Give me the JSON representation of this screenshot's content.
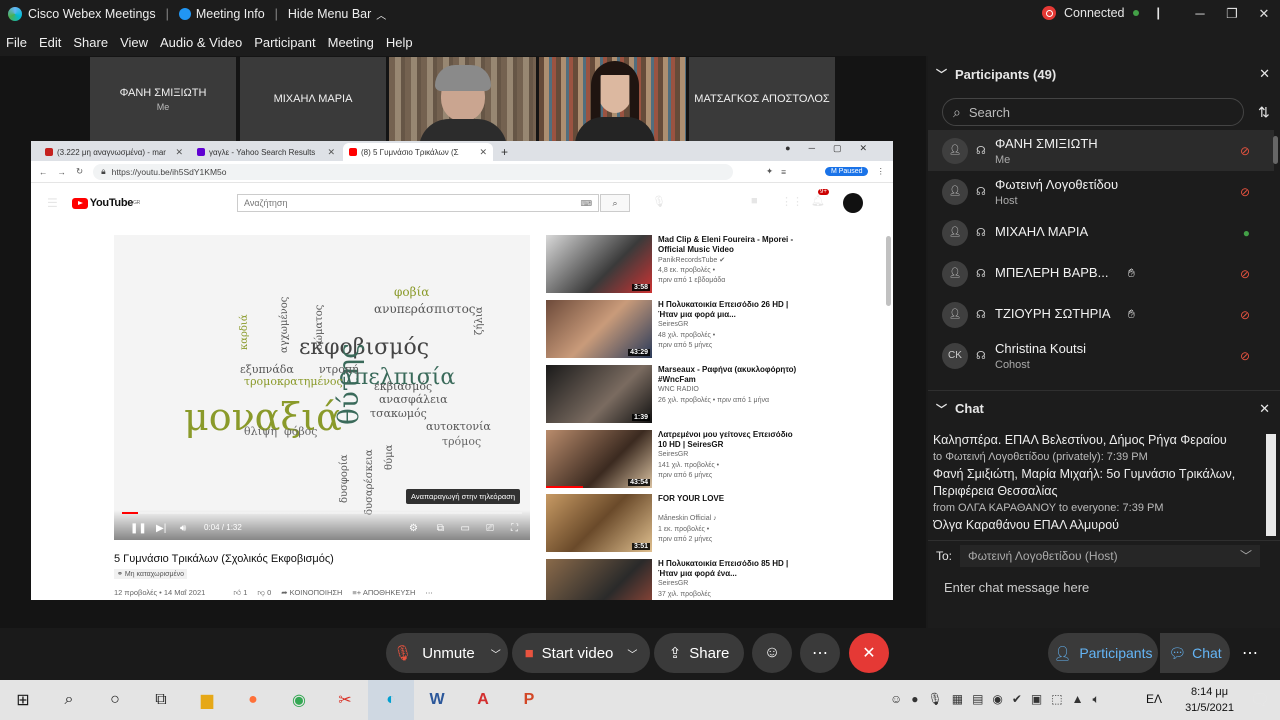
{
  "titlebar": {
    "app": "Cisco Webex Meetings",
    "meeting_info": "Meeting Info",
    "hide_menu": "Hide Menu Bar",
    "status": "Connected"
  },
  "menu": [
    "File",
    "Edit",
    "Share",
    "View",
    "Audio & Video",
    "Participant",
    "Meeting",
    "Help"
  ],
  "thumbnails": [
    {
      "name": "ΦΑΝΗ ΣΜΙΞΙΩΤΗ",
      "sub": "Me"
    },
    {
      "name": "ΜΙΧΑΗΛ ΜΑΡΙΑ",
      "sub": ""
    },
    {
      "name": "ΜΑΤΣΑΓΚΟΣ ΑΠΟΣΤΟΛΟΣ",
      "sub": ""
    }
  ],
  "browser": {
    "tabs": [
      {
        "label": "(3.222 μη αναγνωσμένα) - mar",
        "color": "#c5221f"
      },
      {
        "label": "γαγλε - Yahoo Search Results",
        "color": "#6001d2"
      },
      {
        "label": "(8) 5 Γυμνάσιο Τρικάλων (Σ",
        "color": "#ff0000"
      }
    ],
    "url": "https://youtu.be/ih5SdY1KM5o",
    "profile_status": "Paused",
    "profile_initial": "M",
    "search_placeholder": "Αναζήτηση",
    "logo": "YouTube",
    "logo_region": "GR",
    "notifications": "9+"
  },
  "video": {
    "tooltip": "Αναπαραγωγή στην τηλεόραση",
    "time": "0:04 / 1:32",
    "progress": 0.04,
    "title": "5 Γυμνάσιο Τρικάλων (Σχολικός Εκφοβισμός)",
    "badge": "Μη καταχωρισμένο",
    "views_date": "12 προβολές • 14 Μαΐ 2021",
    "likes": "1",
    "dislikes": "0",
    "share": "ΚΟΙΝΟΠΟΙΗΣΗ",
    "save": "ΑΠΟΘΗΚΕΥΣΗ",
    "words": [
      "μοναξιά",
      "εκφοβισμός",
      "απελπισία",
      "θύτης",
      "φοβία",
      "ανυπεράσπιστος",
      "φόβος",
      "θλίψη",
      "τρόμος",
      "αυτοκτονία",
      "τσακωμός",
      "ανασφάλεια",
      "εκβιασμός",
      "τρομοκρατημένος",
      "εξυπνάδα",
      "ντροπή",
      "δυσφορία",
      "καρδιά",
      "αγχωμένος",
      "θύμα",
      "σώματος",
      "δυσαρέσκεια",
      "ζήλια"
    ]
  },
  "recommended": [
    {
      "title": "Mad Clip & Eleni Foureira - Mporei - Official Music Video",
      "channel": "PanikRecordsTube ✔",
      "views": "4,8 εκ. προβολές •",
      "age": "πριν από 1 εβδομάδα",
      "dur": "3:58",
      "progress": 0.0
    },
    {
      "title": "Η Πολυκατοικία Επεισόδιο 26 HD | Ήταν μια φορά μια...",
      "channel": "SeiresGR",
      "views": "48 χιλ. προβολές •",
      "age": "πριν από 5 μήνες",
      "dur": "43:29",
      "progress": 0.0
    },
    {
      "title": "Marseaux - Ραφήνα (ακυκλοφόρητο) #WncFam",
      "channel": "WNC RADIO",
      "views": "26 χιλ. προβολές • πριν από 1 μήνα",
      "age": "",
      "dur": "1:39",
      "progress": 0.0
    },
    {
      "title": "Λατρεμένοι μου γείτονες Επεισόδιο 10 HD | SeiresGR",
      "channel": "SeiresGR",
      "views": "141 χιλ. προβολές •",
      "age": "πριν από 6 μήνες",
      "dur": "43:54",
      "progress": 0.35
    },
    {
      "title": "FOR YOUR LOVE",
      "channel": "Måneskin Official ♪",
      "views": "1 εκ. προβολές •",
      "age": "πριν από 2 μήνες",
      "dur": "3:51",
      "progress": 0.0
    },
    {
      "title": "Η Πολυκατοικία Επεισόδιο 85 HD | Ήταν μια φορά ένα...",
      "channel": "SeiresGR",
      "views": "37 χιλ. προβολές",
      "age": "",
      "dur": "",
      "progress": 0.0
    }
  ],
  "participants": {
    "header": "Participants (49)",
    "search": "Search",
    "list": [
      {
        "name": "ΦΑΝΗ ΣΜΙΞΙΩΤΗ",
        "role": "Me",
        "muted": true,
        "hand": false,
        "initials": ""
      },
      {
        "name": "Φωτεινή Λογοθετίδου",
        "role": "Host",
        "muted": true,
        "hand": false,
        "initials": ""
      },
      {
        "name": "ΜΙΧΑΗΛ ΜΑΡΙΑ",
        "role": "",
        "muted": false,
        "hand": false,
        "initials": ""
      },
      {
        "name": "ΜΠΕΛΕΡΗ ΒΑΡΒ...",
        "role": "",
        "muted": true,
        "hand": true,
        "initials": ""
      },
      {
        "name": "ΤΖΙΟΥΡΗ ΣΩΤΗΡΙΑ",
        "role": "",
        "muted": true,
        "hand": true,
        "initials": ""
      },
      {
        "name": "Christina Koutsi",
        "role": "Cohost",
        "muted": true,
        "hand": false,
        "initials": "CK"
      }
    ]
  },
  "chat": {
    "header": "Chat",
    "messages": [
      {
        "type": "text",
        "text": "Καλησπέρα. ΕΠΑΛ Βελεστίνου, Δήμος Ρήγα Φεραίου"
      },
      {
        "type": "meta",
        "text": "to Φωτεινή Λογοθετίδου (privately):    7:39 PM"
      },
      {
        "type": "text",
        "text": "Φανή Σμιξιώτη, Μαρία Μιχαήλ: 5ο Γυμνάσιο Τρικάλων, Περιφέρεια Θεσσαλίας"
      },
      {
        "type": "meta",
        "text": "from ΟΛΓΑ ΚΑΡΑΘΑΝΟΥ to everyone:    7:39 PM"
      },
      {
        "type": "text",
        "text": "Όλγα Καραθάνου ΕΠΑΛ Αλμυρού"
      }
    ],
    "to_label": "To:",
    "to_value": "Φωτεινή Λογοθετίδου (Host)",
    "input_placeholder": "Enter chat message here"
  },
  "controls": {
    "unmute": "Unmute",
    "start_video": "Start video",
    "share": "Share",
    "participants": "Participants",
    "chat": "Chat"
  },
  "taskbar": {
    "lang": "ΕΛ",
    "time": "8:14 μμ",
    "date": "31/5/2021"
  },
  "colors": {
    "end_call": "#e53935",
    "accent": "#64b5f6",
    "muted_mic": "#e8533f",
    "active_mic": "#43a047"
  }
}
